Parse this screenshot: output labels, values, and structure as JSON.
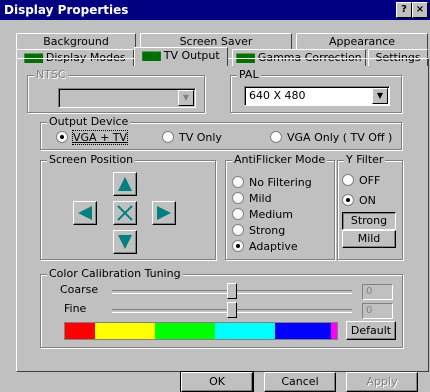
{
  "window": {
    "title": "Display Properties",
    "help_glyph": "?",
    "close_glyph": "×"
  },
  "tabs_row_back": [
    "Background",
    "Screen Saver",
    "Appearance"
  ],
  "tabs_row_front": [
    {
      "label": "Display Modes",
      "icon": "nvidia-icon"
    },
    {
      "label": "TV Output",
      "icon": "nvidia-icon",
      "active": true
    },
    {
      "label": "Gamma Correction",
      "icon": "nvidia-icon"
    },
    {
      "label": "Settings"
    }
  ],
  "ntsc": {
    "label": "NTSC",
    "value": "",
    "disabled": true
  },
  "pal": {
    "label": "PAL",
    "value": "640 X 480"
  },
  "output_device": {
    "label": "Output Device",
    "options": [
      {
        "label": "VGA + TV",
        "selected": true
      },
      {
        "label": "TV Only",
        "selected": false
      },
      {
        "label": "VGA Only ( TV Off )",
        "selected": false
      }
    ]
  },
  "screen_position": {
    "label": "Screen Position",
    "center_glyph": "×"
  },
  "antiflicker": {
    "label": "AntiFlicker Mode",
    "options": [
      {
        "label": "No Filtering",
        "selected": false
      },
      {
        "label": "Mild",
        "selected": false
      },
      {
        "label": "Medium",
        "selected": false
      },
      {
        "label": "Strong",
        "selected": false
      },
      {
        "label": "Adaptive",
        "selected": true
      }
    ]
  },
  "y_filter": {
    "label": "Y Filter",
    "options": [
      {
        "label": "OFF",
        "selected": false
      },
      {
        "label": "ON",
        "selected": true
      }
    ],
    "buttons": {
      "strong": "Strong",
      "mild": "Mild"
    }
  },
  "color_calibration": {
    "label": "Color Calibration Tuning",
    "coarse": {
      "label": "Coarse",
      "value": "0",
      "position": 0.5
    },
    "fine": {
      "label": "Fine",
      "value": "0",
      "position": 0.5
    },
    "default_button": "Default",
    "bar_colors": [
      "#ff0000",
      "#ffff00",
      "#00ff00",
      "#00ffff",
      "#0000ff",
      "#ff00ff"
    ]
  },
  "footer": {
    "ok": "OK",
    "cancel": "Cancel",
    "apply": "Apply"
  },
  "colors": {
    "titlebar": "#000080",
    "arrow": "#008080",
    "face": "#c0c0c0"
  }
}
